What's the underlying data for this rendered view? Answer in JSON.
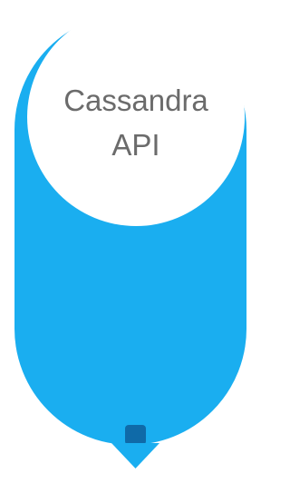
{
  "diagram": {
    "label_line1": "Cassandra",
    "label_line2": "API",
    "colors": {
      "capsule": "#1aaef0",
      "capsule_border": "#ffffff",
      "circle": "#ffffff",
      "arrow_shaft": "#0f6aa8",
      "arrow_head": "#1aaef0",
      "text": "#6b6b6b"
    }
  }
}
